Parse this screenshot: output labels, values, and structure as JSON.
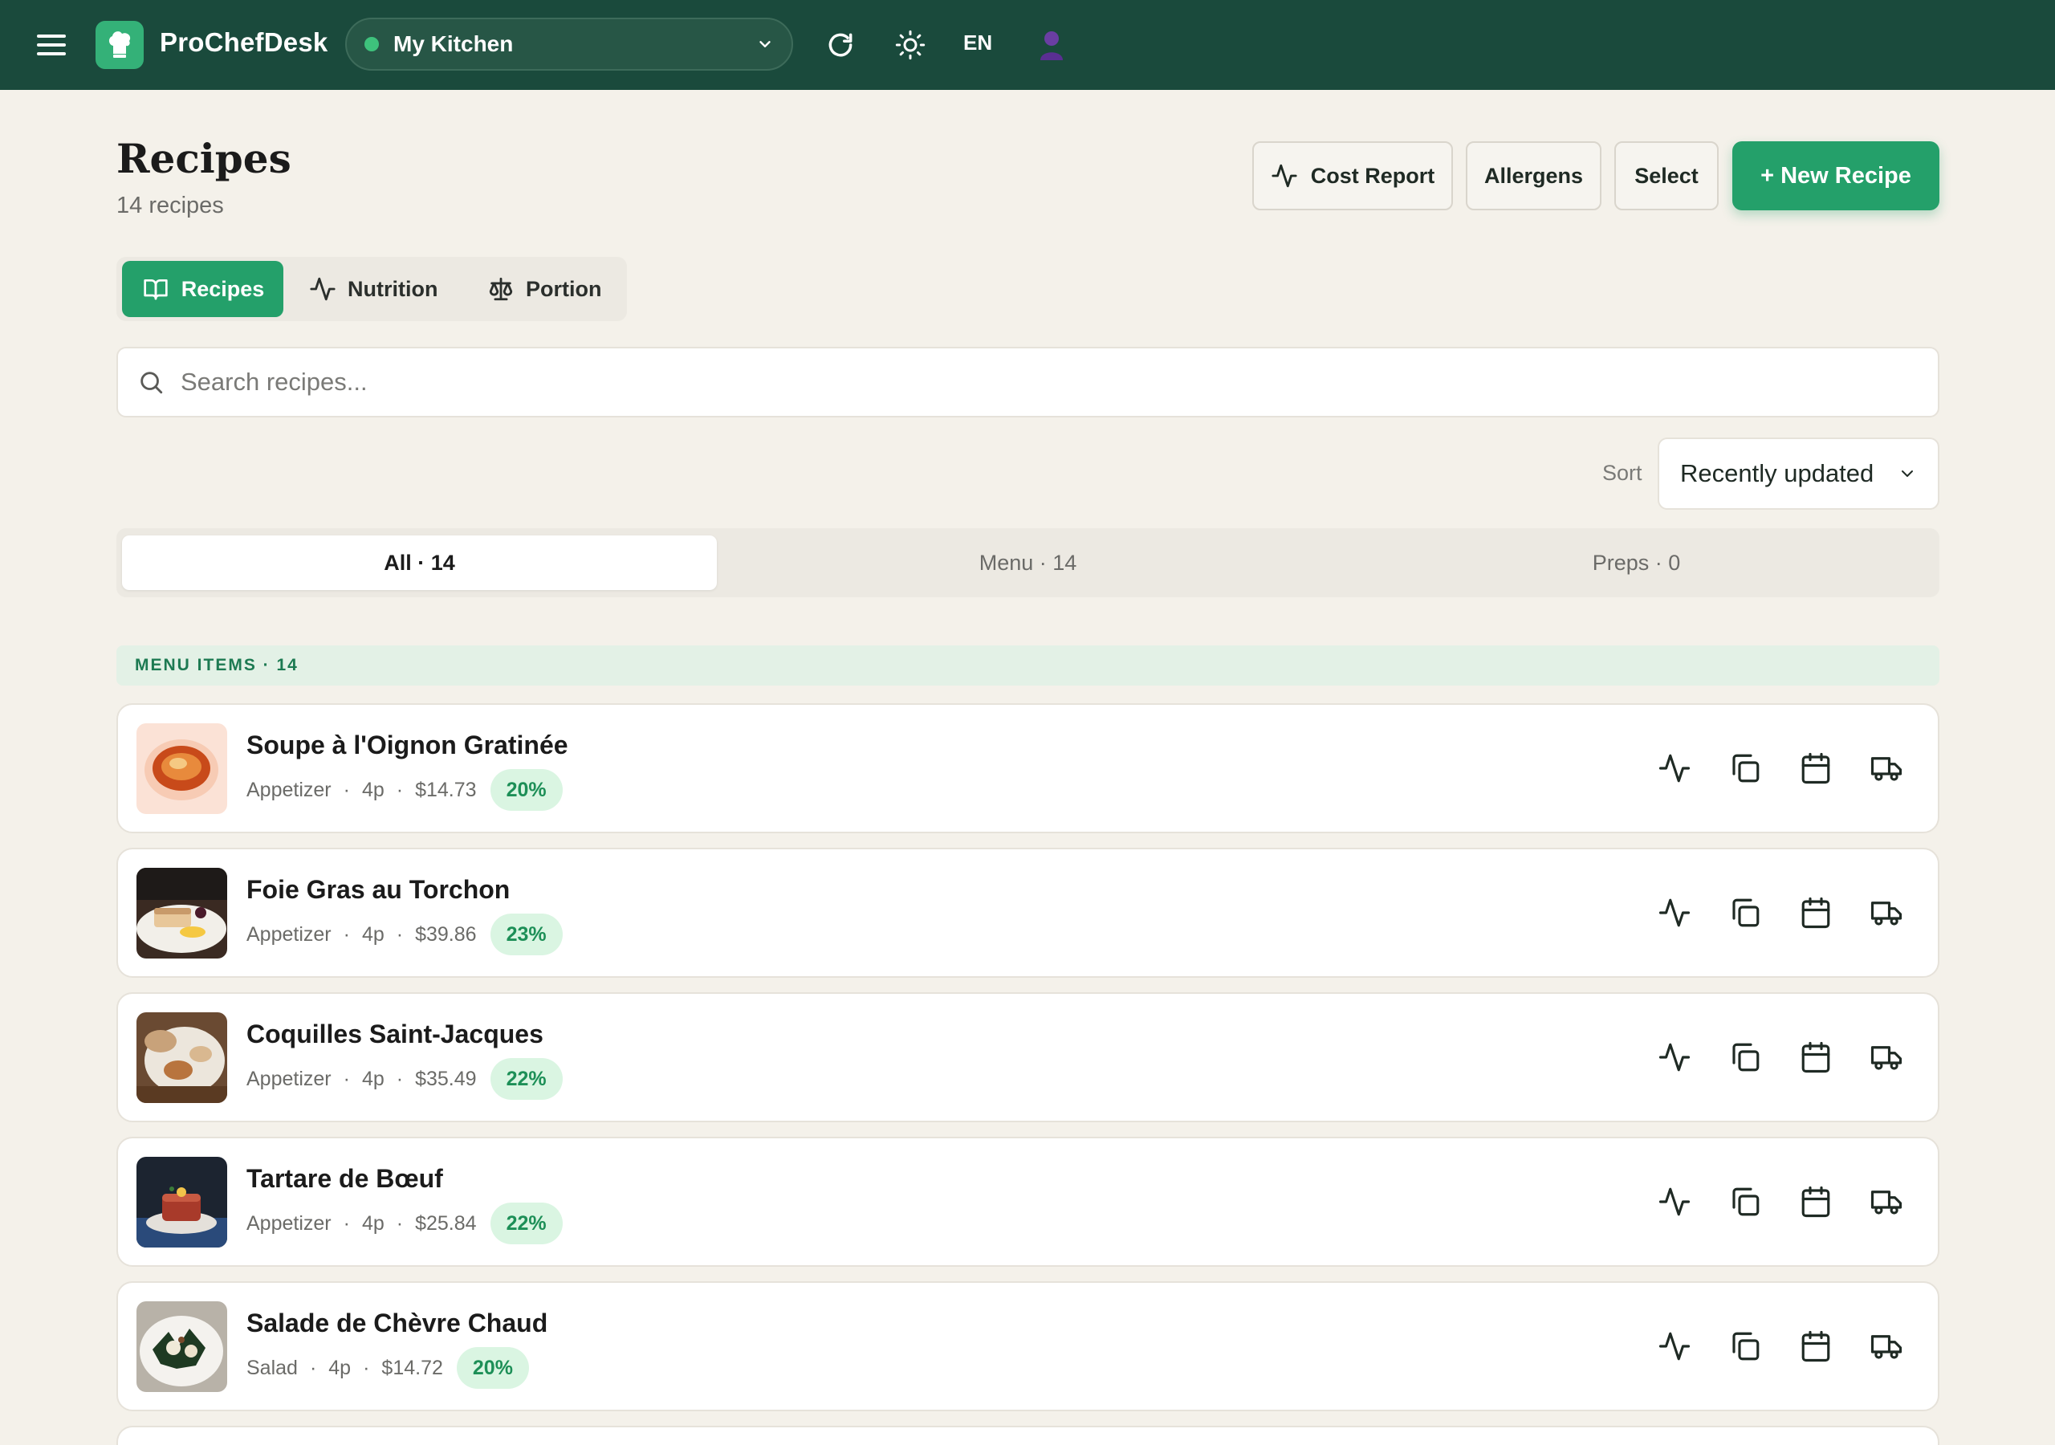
{
  "topbar": {
    "brand": "ProChefDesk",
    "kitchen": "My Kitchen",
    "language": "EN"
  },
  "icons": {
    "menu": "menu-icon",
    "logo": "chef-hat-icon",
    "refresh": "refresh-icon",
    "theme": "sun-icon",
    "user": "user-avatar-icon",
    "search": "search-icon",
    "nutrition": "activity-icon",
    "copy": "copy-icon",
    "schedule": "calendar-icon",
    "delivery": "truck-icon"
  },
  "header": {
    "title": "Recipes",
    "count": "14 recipes",
    "cost_report": "Cost Report",
    "allergens": "Allergens",
    "select": "Select",
    "new_recipe": "+ New Recipe"
  },
  "view_tabs": [
    {
      "label": "Recipes",
      "active": true
    },
    {
      "label": "Nutrition",
      "active": false
    },
    {
      "label": "Portion",
      "active": false
    }
  ],
  "search": {
    "placeholder": "Search recipes..."
  },
  "sort": {
    "label": "Sort",
    "value": "Recently updated"
  },
  "filters": [
    {
      "label": "All · 14",
      "active": true
    },
    {
      "label": "Menu · 14",
      "active": false
    },
    {
      "label": "Preps · 0",
      "active": false
    }
  ],
  "section": {
    "title": "MENU ITEMS · 14"
  },
  "recipes": [
    {
      "name": "Soupe à l'Oignon Gratinée",
      "category": "Appetizer",
      "portions": "4p",
      "cost": "$14.73",
      "food_cost_pct": "20%"
    },
    {
      "name": "Foie Gras au Torchon",
      "category": "Appetizer",
      "portions": "4p",
      "cost": "$39.86",
      "food_cost_pct": "23%"
    },
    {
      "name": "Coquilles Saint-Jacques",
      "category": "Appetizer",
      "portions": "4p",
      "cost": "$35.49",
      "food_cost_pct": "22%"
    },
    {
      "name": "Tartare de Bœuf",
      "category": "Appetizer",
      "portions": "4p",
      "cost": "$25.84",
      "food_cost_pct": "22%"
    },
    {
      "name": "Salade de Chèvre Chaud",
      "category": "Salad",
      "portions": "4p",
      "cost": "$14.72",
      "food_cost_pct": "20%"
    }
  ],
  "colors": {
    "topbar": "#1a4a3c",
    "accent": "#24a06a",
    "background": "#f4f1ea",
    "badge_bg": "#daf5e2",
    "badge_text": "#1d8f57"
  }
}
